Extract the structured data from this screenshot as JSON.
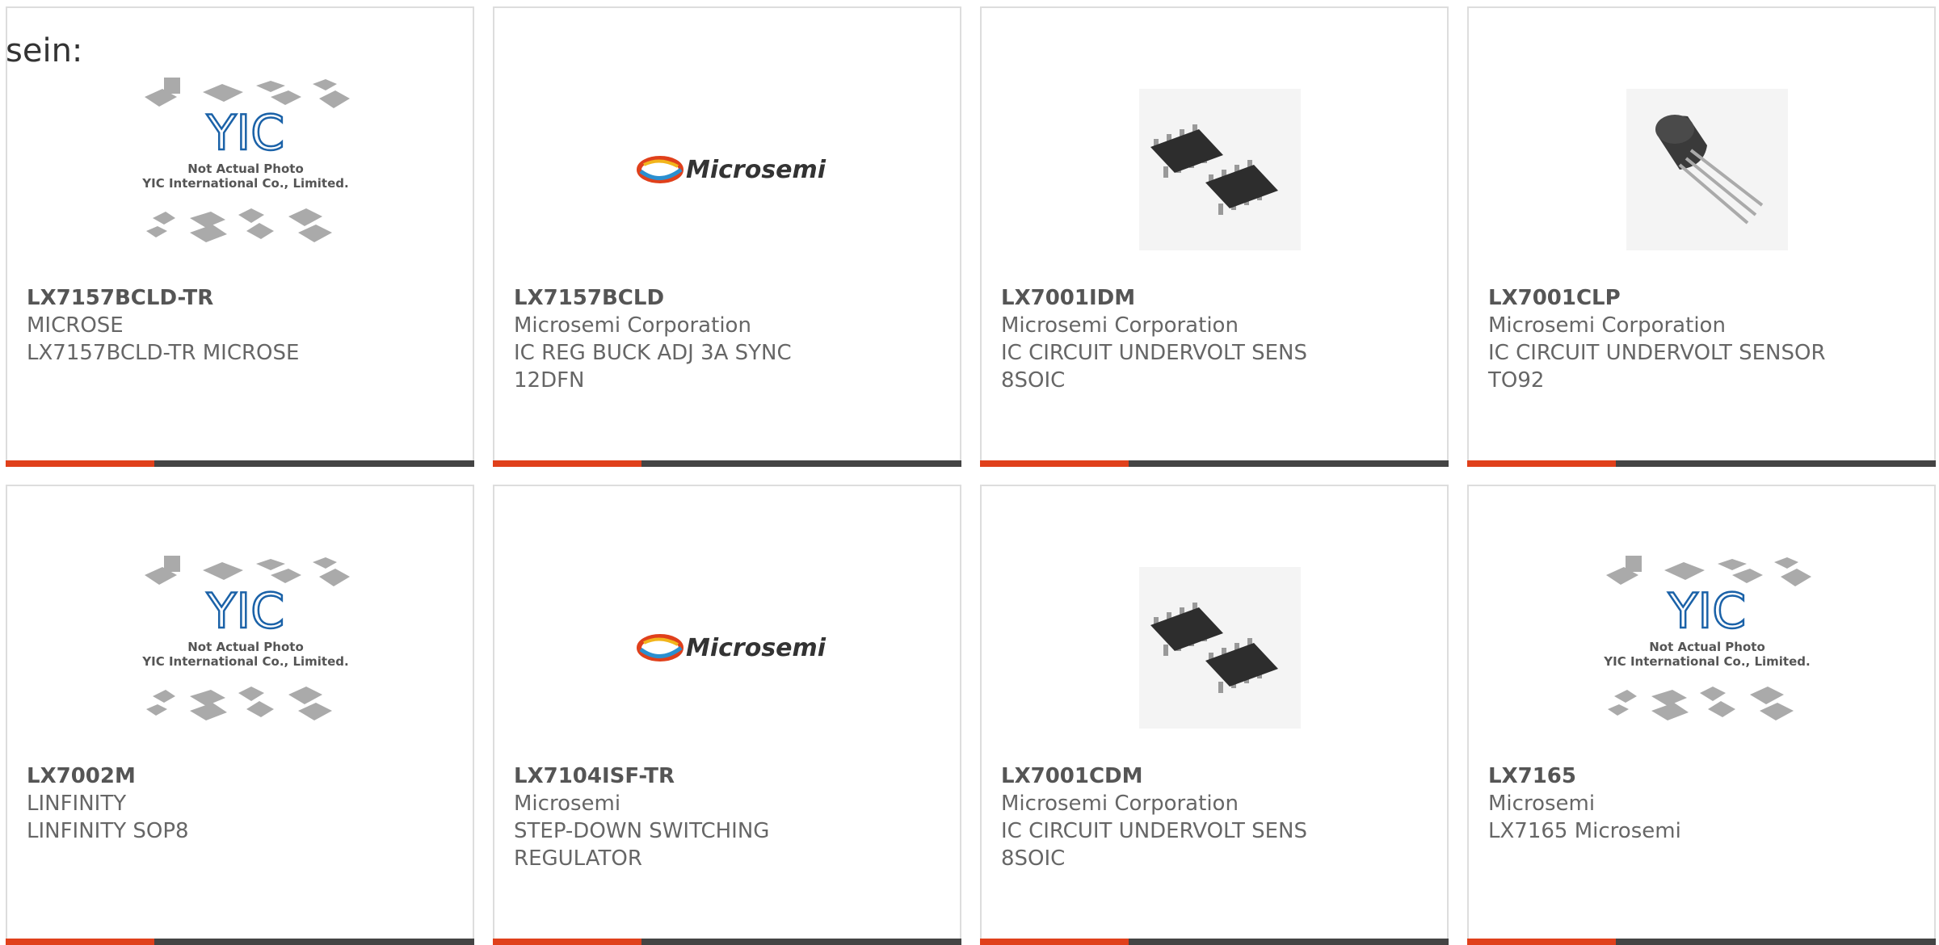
{
  "lead_text": "sein:",
  "placeholder": {
    "brand": "YIC",
    "line1": "Not Actual Photo",
    "line2": "YIC International Co., Limited."
  },
  "logo_text": "Microsemi",
  "colors": {
    "accent": "#e0401b",
    "bar": "#444444",
    "border": "#dddddd",
    "text": "#666666"
  },
  "products": [
    {
      "part": "LX7157BCLD-TR",
      "maker": "MICROSE",
      "desc": "LX7157BCLD-TR MICROSE",
      "image": "placeholder"
    },
    {
      "part": "LX7157BCLD",
      "maker": "Microsemi Corporation",
      "desc": "IC REG BUCK ADJ 3A SYNC 12DFN",
      "image": "microsemi-logo"
    },
    {
      "part": "LX7001IDM",
      "maker": "Microsemi Corporation",
      "desc": "IC CIRCUIT UNDERVOLT SENS 8SOIC",
      "image": "soic-chip"
    },
    {
      "part": "LX7001CLP",
      "maker": "Microsemi Corporation",
      "desc": "IC CIRCUIT UNDERVOLT SENSOR TO92",
      "image": "to92-transistor"
    },
    {
      "part": "LX7002M",
      "maker": "LINFINITY",
      "desc": "LINFINITY SOP8",
      "image": "placeholder"
    },
    {
      "part": "LX7104ISF-TR",
      "maker": "Microsemi",
      "desc": "STEP-DOWN SWITCHING REGULATOR",
      "image": "microsemi-logo"
    },
    {
      "part": "LX7001CDM",
      "maker": "Microsemi Corporation",
      "desc": "IC CIRCUIT UNDERVOLT SENS 8SOIC",
      "image": "soic-chip"
    },
    {
      "part": "LX7165",
      "maker": "Microsemi",
      "desc": "LX7165 Microsemi",
      "image": "placeholder"
    }
  ]
}
